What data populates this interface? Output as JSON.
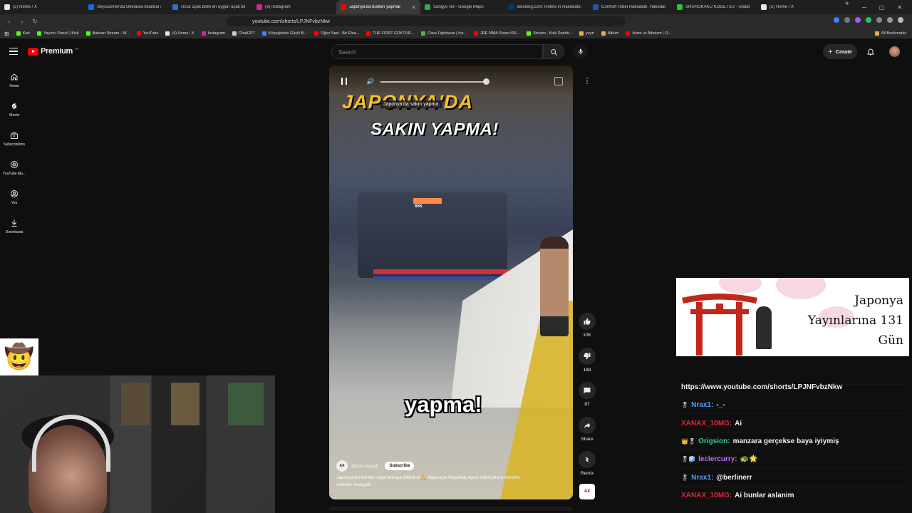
{
  "browser": {
    "tabs": [
      {
        "title": "(2) Home / X",
        "color": "#e8e8e8"
      },
      {
        "title": "Skyscanner'da Okinawa-İstanbul a",
        "color": "#0770e3"
      },
      {
        "title": "Ucuz uçak bileti en uygun uçak bil",
        "color": "#2f6fd6"
      },
      {
        "title": "(9) Instagram",
        "color": "#d6249f"
      },
      {
        "title": "Japonya'da bunları yapmar",
        "color": "#ff0000",
        "active": true
      },
      {
        "title": "Sangyo Rd - Google Maps",
        "color": "#34a853"
      },
      {
        "title": "Booking.com: Hotels in Hakodate.",
        "color": "#003580"
      },
      {
        "title": "Comfort Hotel Hakodate, Hakodat",
        "color": "#1a56b8"
      },
      {
        "title": "SHUHOKAKU KOGETSU - Update",
        "color": "#25c93c"
      },
      {
        "title": "(2) Home / X",
        "color": "#e8e8e8"
      }
    ],
    "url": "youtube.com/shorts/LPJNFvbzNkw",
    "bookmarks": [
      {
        "label": "Kick",
        "color": "#53fc18"
      },
      {
        "label": "Yayıncı Paneli | Kick",
        "color": "#53fc18"
      },
      {
        "label": "ilkinsan Stream - W...",
        "color": "#53fc18"
      },
      {
        "label": "YouTube",
        "color": "#ff0000"
      },
      {
        "label": "(4) Home / X",
        "color": "#e8e8e8"
      },
      {
        "label": "Instagram",
        "color": "#d6249f"
      },
      {
        "label": "ChatGPT",
        "color": "#cccccc"
      },
      {
        "label": "Köpeğinizle Güçlü B...",
        "color": "#4285f4"
      },
      {
        "label": "Oğuz Sasi - Bir Efsa...",
        "color": "#ff0000"
      },
      {
        "label": "THE FIRST GOKTUR...",
        "color": "#ff0000"
      },
      {
        "label": "Cave Fightwear | Ins...",
        "color": "#5bb04a"
      },
      {
        "label": "JRE MMA Show #16...",
        "color": "#ff0000"
      },
      {
        "label": "Stream - Kick Dashb...",
        "color": "#53fc18"
      },
      {
        "label": "yeyn",
        "color": "#e0b04a"
      },
      {
        "label": "Albüm",
        "color": "#e0b04a"
      },
      {
        "label": "İslam vs Atheism | O...",
        "color": "#ff0000"
      }
    ],
    "all_bookmarks": "All Bookmarks"
  },
  "youtube": {
    "brand": "Premium",
    "region": "TR",
    "search_placeholder": "Search",
    "create_label": "Create",
    "sidebar": [
      {
        "label": "Home",
        "icon": "home-icon"
      },
      {
        "label": "Shorts",
        "icon": "shorts-icon"
      },
      {
        "label": "Subscriptions",
        "icon": "subscriptions-icon"
      },
      {
        "label": "YouTube Mu...",
        "icon": "youtube-music-icon"
      },
      {
        "label": "You",
        "icon": "you-icon"
      },
      {
        "label": "Downloads",
        "icon": "download-icon"
      }
    ]
  },
  "short": {
    "tooltip": "Japonya'da sakın yapma.",
    "overlay_line1": "JAPONYA'DA",
    "overlay_line2": "SAKIN YAPMA!",
    "overlay_caption": "yapma!",
    "train_sign": "65K",
    "channel": "@Axi-seyyah",
    "channel_logo": "AX",
    "subscribe": "Subscribe",
    "description": "Japonya'da bunları yapmamaya dikkat et🙏 #japonya #seyahat #gezi #dünyaturu #shorts #rehber #seyyah",
    "likes": "10K",
    "dislikes": "188",
    "comments": "87",
    "share": "Share",
    "remix": "Remix",
    "remix_thumb": "AX"
  },
  "stream_overlay": {
    "banner_line1": "Japonya",
    "banner_line2": "Yayınlarına 131",
    "banner_line3": "Gün",
    "chat": [
      {
        "badge": "",
        "user": "",
        "user_color": "#ffffff",
        "msg": "https://www.youtube.com/shorts/LPJNFvbzNkw"
      },
      {
        "badge": "🎖",
        "user": "Nrax1:",
        "user_color": "#5a9cff",
        "msg": "-_-"
      },
      {
        "badge": "",
        "user": "XANAX_10MG:",
        "user_color": "#e0283c",
        "msg": "Ai"
      },
      {
        "badge": "👑🎖",
        "user": "Origsion:",
        "user_color": "#2fd58c",
        "msg": "manzara gerçekse baya iyiymiş"
      },
      {
        "badge": "🎖🧊",
        "user": "leclercurry:",
        "user_color": "#c06bff",
        "msg": "🐢🌟"
      },
      {
        "badge": "🎖",
        "user": "Nrax1:",
        "user_color": "#5a9cff",
        "msg": "@berlinerr"
      },
      {
        "badge": "",
        "user": "XANAX_10MG:",
        "user_color": "#e0283c",
        "msg": "Ai bunlar aslanim"
      }
    ]
  }
}
